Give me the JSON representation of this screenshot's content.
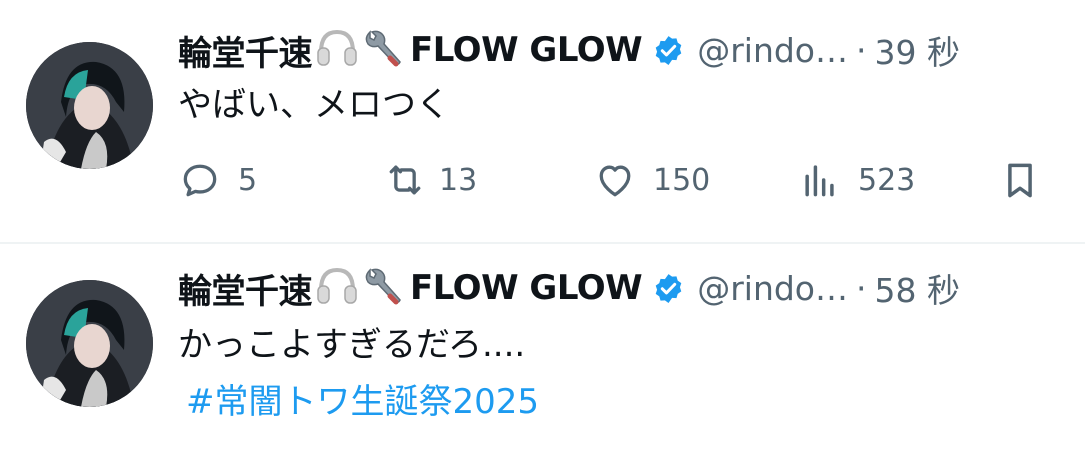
{
  "tweets": [
    {
      "display_name": "輪堂千速",
      "emojis": [
        "headphones-icon",
        "wrench-icon"
      ],
      "name_suffix": "FLOW GLOW",
      "handle": "@rindo…",
      "separator": "·",
      "time": "39 秒",
      "text": "やばい、メロつく",
      "actions": {
        "replies": "5",
        "retweets": "13",
        "likes": "150",
        "views": "523"
      }
    },
    {
      "display_name": "輪堂千速",
      "emojis": [
        "headphones-icon",
        "wrench-icon"
      ],
      "name_suffix": "FLOW GLOW",
      "handle": "@rindo…",
      "separator": "·",
      "time": "58 秒",
      "text": "かっこよすぎるだろ....",
      "hashtag": "#常闇トワ生誕祭2025"
    }
  ],
  "colors": {
    "accent": "#1d9bf0",
    "secondary_text": "#536471",
    "divider": "#eff3f4"
  }
}
